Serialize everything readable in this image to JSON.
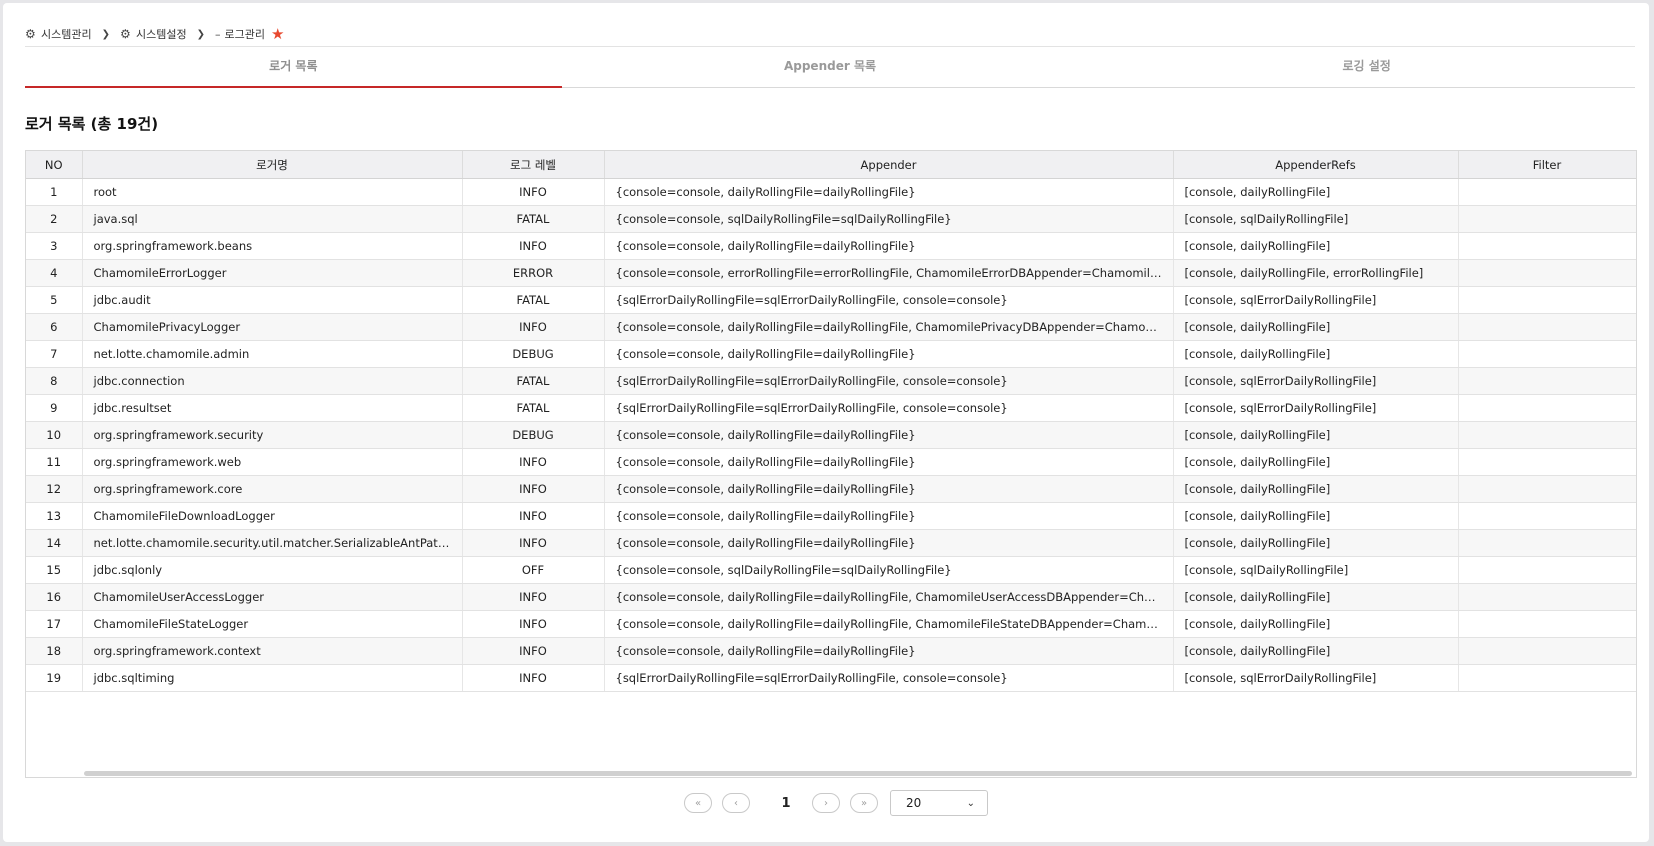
{
  "breadcrumb": {
    "items": [
      {
        "label": "시스템관리",
        "icon": "gear-icon"
      },
      {
        "label": "시스템설정",
        "icon": "gear-icon"
      },
      {
        "label": "로그관리",
        "icon": "dash-icon"
      }
    ],
    "favorite_icon": "star-icon",
    "favorite_color": "#e8492f"
  },
  "tabs": [
    {
      "label": "로거 목록",
      "active": true
    },
    {
      "label": "Appender 목록",
      "active": false
    },
    {
      "label": "로깅 설정",
      "active": false
    }
  ],
  "accent_color": "#c62828",
  "list": {
    "title": "로거 목록 (총 19건)",
    "columns": [
      "NO",
      "로거명",
      "로그 레벨",
      "Appender",
      "AppenderRefs",
      "Filter"
    ],
    "rows": [
      {
        "no": "1",
        "name": "root",
        "level": "INFO",
        "appender": "{console=console, dailyRollingFile=dailyRollingFile}",
        "refs": "[console, dailyRollingFile]",
        "filter": ""
      },
      {
        "no": "2",
        "name": "java.sql",
        "level": "FATAL",
        "appender": "{console=console, sqlDailyRollingFile=sqlDailyRollingFile}",
        "refs": "[console, sqlDailyRollingFile]",
        "filter": ""
      },
      {
        "no": "3",
        "name": "org.springframework.beans",
        "level": "INFO",
        "appender": "{console=console, dailyRollingFile=dailyRollingFile}",
        "refs": "[console, dailyRollingFile]",
        "filter": ""
      },
      {
        "no": "4",
        "name": "ChamomileErrorLogger",
        "level": "ERROR",
        "appender": "{console=console, errorRollingFile=errorRollingFile, ChamomileErrorDBAppender=ChamomileErrorDBAppe...",
        "refs": "[console, dailyRollingFile, errorRollingFile]",
        "filter": ""
      },
      {
        "no": "5",
        "name": "jdbc.audit",
        "level": "FATAL",
        "appender": "{sqlErrorDailyRollingFile=sqlErrorDailyRollingFile, console=console}",
        "refs": "[console, sqlErrorDailyRollingFile]",
        "filter": ""
      },
      {
        "no": "6",
        "name": "ChamomilePrivacyLogger",
        "level": "INFO",
        "appender": "{console=console, dailyRollingFile=dailyRollingFile, ChamomilePrivacyDBAppender=ChamomilePrivacyDBA...",
        "refs": "[console, dailyRollingFile]",
        "filter": ""
      },
      {
        "no": "7",
        "name": "net.lotte.chamomile.admin",
        "level": "DEBUG",
        "appender": "{console=console, dailyRollingFile=dailyRollingFile}",
        "refs": "[console, dailyRollingFile]",
        "filter": ""
      },
      {
        "no": "8",
        "name": "jdbc.connection",
        "level": "FATAL",
        "appender": "{sqlErrorDailyRollingFile=sqlErrorDailyRollingFile, console=console}",
        "refs": "[console, sqlErrorDailyRollingFile]",
        "filter": ""
      },
      {
        "no": "9",
        "name": "jdbc.resultset",
        "level": "FATAL",
        "appender": "{sqlErrorDailyRollingFile=sqlErrorDailyRollingFile, console=console}",
        "refs": "[console, sqlErrorDailyRollingFile]",
        "filter": ""
      },
      {
        "no": "10",
        "name": "org.springframework.security",
        "level": "DEBUG",
        "appender": "{console=console, dailyRollingFile=dailyRollingFile}",
        "refs": "[console, dailyRollingFile]",
        "filter": ""
      },
      {
        "no": "11",
        "name": "org.springframework.web",
        "level": "INFO",
        "appender": "{console=console, dailyRollingFile=dailyRollingFile}",
        "refs": "[console, dailyRollingFile]",
        "filter": ""
      },
      {
        "no": "12",
        "name": "org.springframework.core",
        "level": "INFO",
        "appender": "{console=console, dailyRollingFile=dailyRollingFile}",
        "refs": "[console, dailyRollingFile]",
        "filter": ""
      },
      {
        "no": "13",
        "name": "ChamomileFileDownloadLogger",
        "level": "INFO",
        "appender": "{console=console, dailyRollingFile=dailyRollingFile}",
        "refs": "[console, dailyRollingFile]",
        "filter": ""
      },
      {
        "no": "14",
        "name": "net.lotte.chamomile.security.util.matcher.SerializableAntPathRequest...",
        "level": "INFO",
        "appender": "{console=console, dailyRollingFile=dailyRollingFile}",
        "refs": "[console, dailyRollingFile]",
        "filter": ""
      },
      {
        "no": "15",
        "name": "jdbc.sqlonly",
        "level": "OFF",
        "appender": "{console=console, sqlDailyRollingFile=sqlDailyRollingFile}",
        "refs": "[console, sqlDailyRollingFile]",
        "filter": ""
      },
      {
        "no": "16",
        "name": "ChamomileUserAccessLogger",
        "level": "INFO",
        "appender": "{console=console, dailyRollingFile=dailyRollingFile, ChamomileUserAccessDBAppender=ChamomileUserAc...",
        "refs": "[console, dailyRollingFile]",
        "filter": ""
      },
      {
        "no": "17",
        "name": "ChamomileFileStateLogger",
        "level": "INFO",
        "appender": "{console=console, dailyRollingFile=dailyRollingFile, ChamomileFileStateDBAppender=ChamomileFileStateD...",
        "refs": "[console, dailyRollingFile]",
        "filter": ""
      },
      {
        "no": "18",
        "name": "org.springframework.context",
        "level": "INFO",
        "appender": "{console=console, dailyRollingFile=dailyRollingFile}",
        "refs": "[console, dailyRollingFile]",
        "filter": ""
      },
      {
        "no": "19",
        "name": "jdbc.sqltiming",
        "level": "INFO",
        "appender": "{sqlErrorDailyRollingFile=sqlErrorDailyRollingFile, console=console}",
        "refs": "[console, sqlErrorDailyRollingFile]",
        "filter": ""
      }
    ]
  },
  "pagination": {
    "first_icon": "double-chevron-left-icon",
    "prev_icon": "chevron-left-icon",
    "current_page": "1",
    "next_icon": "chevron-right-icon",
    "last_icon": "double-chevron-right-icon",
    "page_size": "20",
    "page_size_icon": "chevron-down-icon"
  }
}
